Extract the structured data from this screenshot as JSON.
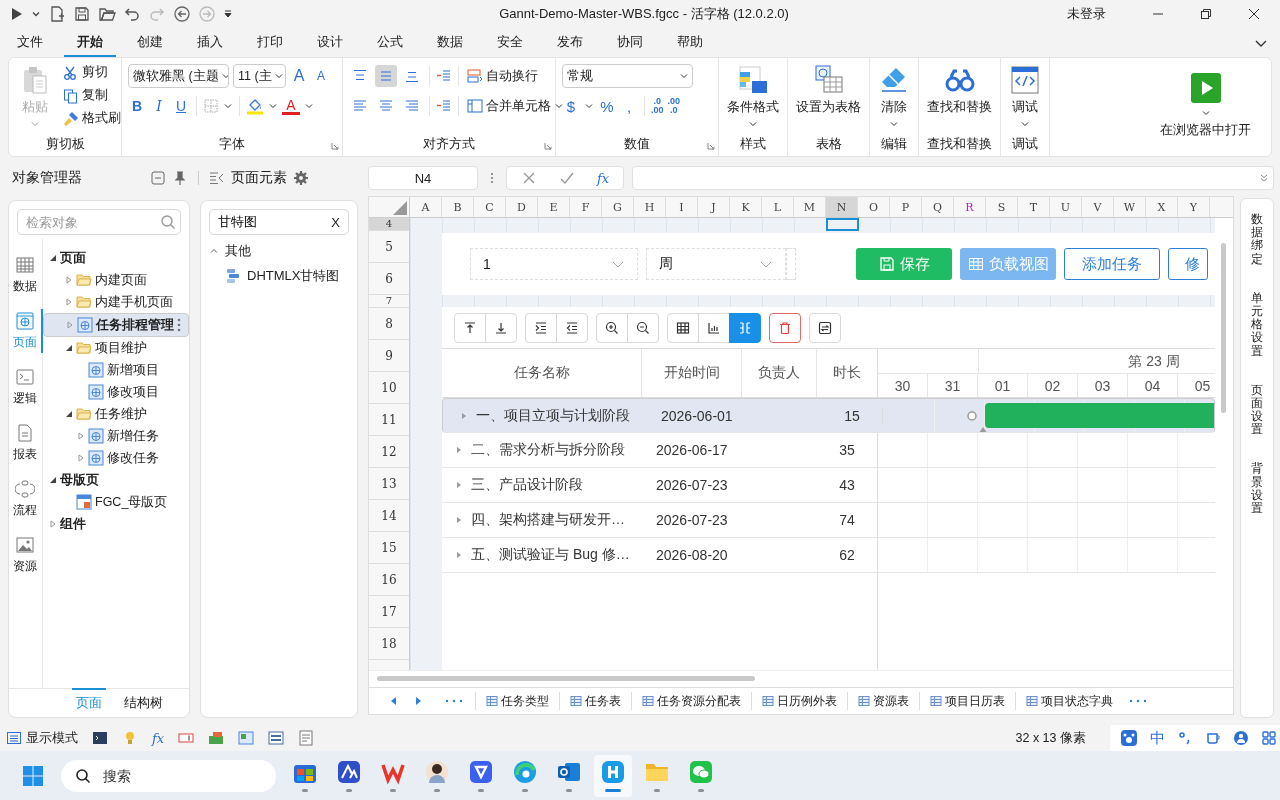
{
  "window": {
    "title": "Gannt-Demo-Master-WBS.fgcc - 活字格 (12.0.2.0)",
    "account": "未登录"
  },
  "menu_tabs": [
    {
      "label": "文件",
      "selected": false
    },
    {
      "label": "开始",
      "selected": true
    },
    {
      "label": "创建",
      "selected": false
    },
    {
      "label": "插入",
      "selected": false
    },
    {
      "label": "打印",
      "selected": false
    },
    {
      "label": "设计",
      "selected": false
    },
    {
      "label": "公式",
      "selected": false
    },
    {
      "label": "数据",
      "selected": false
    },
    {
      "label": "安全",
      "selected": false
    },
    {
      "label": "发布",
      "selected": false
    },
    {
      "label": "协同",
      "selected": false
    },
    {
      "label": "帮助",
      "selected": false
    }
  ],
  "ribbon": {
    "clipboard": {
      "paste": {
        "label": "粘贴",
        "disabled": true
      },
      "items": [
        {
          "kind": "cut",
          "label": "剪切"
        },
        {
          "kind": "copy",
          "label": "复制"
        },
        {
          "kind": "painter",
          "label": "格式刷"
        }
      ],
      "title": "剪切板"
    },
    "font": {
      "name": "微软雅黑 (主题",
      "size": "11 (主",
      "grow": "A",
      "shrink": "A",
      "bold": "B",
      "italic": "I",
      "underline": "U",
      "font_color": "A",
      "title": "字体"
    },
    "alignment": {
      "buttons": [
        {
          "kind": "top",
          "selected": false
        },
        {
          "kind": "middle",
          "selected": true
        },
        {
          "kind": "bottom",
          "selected": false
        },
        {
          "kind": "left",
          "selected": false
        },
        {
          "kind": "center",
          "selected": false
        },
        {
          "kind": "right",
          "selected": false
        }
      ],
      "wrap": "自动换行",
      "merge": "合并单元格",
      "title": "对齐方式"
    },
    "number": {
      "format": "常规",
      "currency": "$",
      "percent": "%",
      "comma": ",",
      "decimals": [
        {
          "top": ".0",
          "bottom": ".00"
        },
        {
          "top": ".00",
          "bottom": ".0"
        }
      ],
      "title": "数值"
    },
    "commands": [
      {
        "kind": "conditional",
        "label": "条件格式",
        "dropdown": true,
        "title": "样式"
      },
      {
        "kind": "table",
        "label": "设置为表格",
        "dropdown": false,
        "title": "表格"
      },
      {
        "kind": "clear",
        "label": "清除",
        "dropdown": true,
        "title": "编辑"
      },
      {
        "kind": "find",
        "label": "查找和替换",
        "dropdown": false,
        "title": "查找和替换"
      },
      {
        "kind": "debug",
        "label": "调试",
        "dropdown": true,
        "title": "调试"
      }
    ],
    "run": {
      "label": "在浏览器中打开"
    }
  },
  "object_manager": {
    "title": "对象管理器",
    "search_placeholder": "检索对象",
    "nav": [
      {
        "kind": "data",
        "label": "数据",
        "selected": false
      },
      {
        "kind": "page",
        "label": "页面",
        "selected": true
      },
      {
        "kind": "logic",
        "label": "逻辑",
        "selected": false
      },
      {
        "kind": "report",
        "label": "报表",
        "selected": false
      },
      {
        "kind": "flow",
        "label": "流程",
        "selected": false
      },
      {
        "kind": "resource",
        "label": "资源",
        "selected": false
      }
    ],
    "tree": [
      {
        "label": "页面",
        "kind": "root",
        "expanded": true,
        "selected": false,
        "children": [
          {
            "label": "内建页面",
            "kind": "folder",
            "expanded": false,
            "selected": false
          },
          {
            "label": "内建手机页面",
            "kind": "folder",
            "expanded": false,
            "selected": false
          },
          {
            "label": "任务排程管理",
            "kind": "page",
            "expanded": false,
            "selected": true
          },
          {
            "label": "项目维护",
            "kind": "folder",
            "expanded": true,
            "selected": false,
            "children": [
              {
                "label": "新增项目",
                "kind": "page",
                "selected": false
              },
              {
                "label": "修改项目",
                "kind": "page",
                "selected": false
              }
            ]
          },
          {
            "label": "任务维护",
            "kind": "folder",
            "expanded": true,
            "selected": false,
            "children": [
              {
                "label": "新增任务",
                "kind": "page",
                "expanded": false,
                "selected": false
              },
              {
                "label": "修改任务",
                "kind": "page",
                "expanded": false,
                "selected": false
              }
            ]
          }
        ]
      },
      {
        "label": "母版页",
        "kind": "root",
        "expanded": true,
        "selected": false,
        "children": [
          {
            "label": "FGC_母版页",
            "kind": "master",
            "selected": false
          }
        ]
      },
      {
        "label": "组件",
        "kind": "root",
        "expanded": false,
        "selected": false
      }
    ],
    "bottom_tabs": [
      {
        "label": "页面",
        "selected": true
      },
      {
        "label": "结构树",
        "selected": false
      }
    ]
  },
  "page_elements": {
    "title": "页面元素",
    "search": "甘特图",
    "clear": "X",
    "groups": [
      {
        "label": "其他",
        "expanded": true,
        "items": [
          {
            "label": "DHTMLX甘特图"
          }
        ]
      }
    ]
  },
  "formula_bar": {
    "cell": "N4",
    "fx": "fx"
  },
  "sheet": {
    "columns": [
      {
        "label": "A",
        "selected": false,
        "marked": false
      },
      {
        "label": "B",
        "selected": false,
        "marked": false
      },
      {
        "label": "C",
        "selected": false,
        "marked": false
      },
      {
        "label": "D",
        "selected": false,
        "marked": false
      },
      {
        "label": "E",
        "selected": false,
        "marked": false
      },
      {
        "label": "F",
        "selected": false,
        "marked": false
      },
      {
        "label": "G",
        "selected": false,
        "marked": false
      },
      {
        "label": "H",
        "selected": false,
        "marked": false
      },
      {
        "label": "I",
        "selected": false,
        "marked": false
      },
      {
        "label": "J",
        "selected": false,
        "marked": false
      },
      {
        "label": "K",
        "selected": false,
        "marked": false
      },
      {
        "label": "L",
        "selected": false,
        "marked": false
      },
      {
        "label": "M",
        "selected": false,
        "marked": false
      },
      {
        "label": "N",
        "selected": true,
        "marked": false
      },
      {
        "label": "O",
        "selected": false,
        "marked": false
      },
      {
        "label": "P",
        "selected": false,
        "marked": false
      },
      {
        "label": "Q",
        "selected": false,
        "marked": false
      },
      {
        "label": "R",
        "selected": false,
        "marked": true
      },
      {
        "label": "S",
        "selected": false,
        "marked": false
      },
      {
        "label": "T",
        "selected": false,
        "marked": false
      },
      {
        "label": "U",
        "selected": false,
        "marked": false
      },
      {
        "label": "V",
        "selected": false,
        "marked": false
      },
      {
        "label": "W",
        "selected": false,
        "marked": false
      },
      {
        "label": "X",
        "selected": false,
        "marked": false
      },
      {
        "label": "Y",
        "selected": false,
        "marked": false
      }
    ],
    "rows": [
      {
        "label": "4",
        "kind": "short",
        "selected": true
      },
      {
        "label": "5",
        "kind": "normal",
        "selected": false
      },
      {
        "label": "6",
        "kind": "normal",
        "selected": false
      },
      {
        "label": "7",
        "kind": "short",
        "selected": false
      },
      {
        "label": "8",
        "kind": "normal",
        "selected": false
      },
      {
        "label": "9",
        "kind": "normal",
        "selected": false
      },
      {
        "label": "10",
        "kind": "normal",
        "selected": false
      },
      {
        "label": "11",
        "kind": "normal",
        "selected": false
      },
      {
        "label": "12",
        "kind": "normal",
        "selected": false
      },
      {
        "label": "13",
        "kind": "normal",
        "selected": false
      },
      {
        "label": "14",
        "kind": "normal",
        "selected": false
      },
      {
        "label": "15",
        "kind": "normal",
        "selected": false
      },
      {
        "label": "16",
        "kind": "normal",
        "selected": false
      },
      {
        "label": "17",
        "kind": "normal",
        "selected": false
      },
      {
        "label": "18",
        "kind": "normal",
        "selected": false
      }
    ]
  },
  "gantt_widget": {
    "selects": [
      "1",
      "周"
    ],
    "buttons": [
      {
        "kind": "primary",
        "label": "保存"
      },
      {
        "kind": "muted",
        "label": "负载视图"
      },
      {
        "kind": "outline",
        "label": "添加任务"
      },
      {
        "kind": "outline",
        "label": "修"
      }
    ],
    "toolbar": [
      [
        {
          "kind": "arrow-to-top",
          "selected": false
        },
        {
          "kind": "arrow-to-bottom",
          "selected": false
        }
      ],
      [
        {
          "kind": "indent",
          "selected": false
        },
        {
          "kind": "outdent",
          "selected": false
        }
      ],
      [
        {
          "kind": "zoom-in",
          "selected": false
        },
        {
          "kind": "zoom-out",
          "selected": false
        }
      ],
      [
        {
          "kind": "grid",
          "selected": false
        },
        {
          "kind": "chart",
          "selected": false
        },
        {
          "kind": "columns",
          "selected": true
        }
      ],
      [
        {
          "kind": "trash",
          "selected": false
        }
      ],
      [
        {
          "kind": "refresh",
          "selected": false
        }
      ]
    ],
    "columns": [
      "任务名称",
      "开始时间",
      "负责人",
      "时长"
    ],
    "week": "第 23 周",
    "days": [
      "30",
      "31",
      "01",
      "02",
      "03",
      "04",
      "05"
    ],
    "tasks": [
      {
        "name": "一、项目立项与计划阶段",
        "start": "2026-06-01",
        "duration": "15",
        "selected": true,
        "bar": true
      },
      {
        "name": "二、需求分析与拆分阶段",
        "start": "2026-06-17",
        "duration": "35",
        "selected": false,
        "bar": false
      },
      {
        "name": "三、产品设计阶段",
        "start": "2026-07-23",
        "duration": "43",
        "selected": false,
        "bar": false
      },
      {
        "name": "四、架构搭建与研发开…",
        "start": "2026-07-23",
        "duration": "74",
        "selected": false,
        "bar": false
      },
      {
        "name": "五、测试验证与 Bug 修…",
        "start": "2026-08-20",
        "duration": "62",
        "selected": false,
        "bar": false
      }
    ]
  },
  "sheet_tabs": [
    "任务类型",
    "任务表",
    "任务资源分配表",
    "日历例外表",
    "资源表",
    "项目日历表",
    "项目状态字典"
  ],
  "side_tabs": [
    "数据绑定",
    "单元格设置",
    "页面设置",
    "背景设置"
  ],
  "status_bar": {
    "mode": "显示模式",
    "fx": "fx",
    "size": "32 x 13 像素",
    "ime": "中"
  },
  "taskbar": {
    "search_placeholder": "搜索",
    "apps": [
      {
        "kind": "store",
        "selected": false
      },
      {
        "kind": "triangle",
        "selected": false
      },
      {
        "kind": "red",
        "selected": false
      },
      {
        "kind": "avatar",
        "selected": false
      },
      {
        "kind": "knot",
        "selected": false
      },
      {
        "kind": "edge",
        "selected": false
      },
      {
        "kind": "mail",
        "selected": false
      },
      {
        "kind": "blue",
        "selected": true
      },
      {
        "kind": "folder",
        "selected": false
      },
      {
        "kind": "chat",
        "selected": false
      }
    ]
  }
}
